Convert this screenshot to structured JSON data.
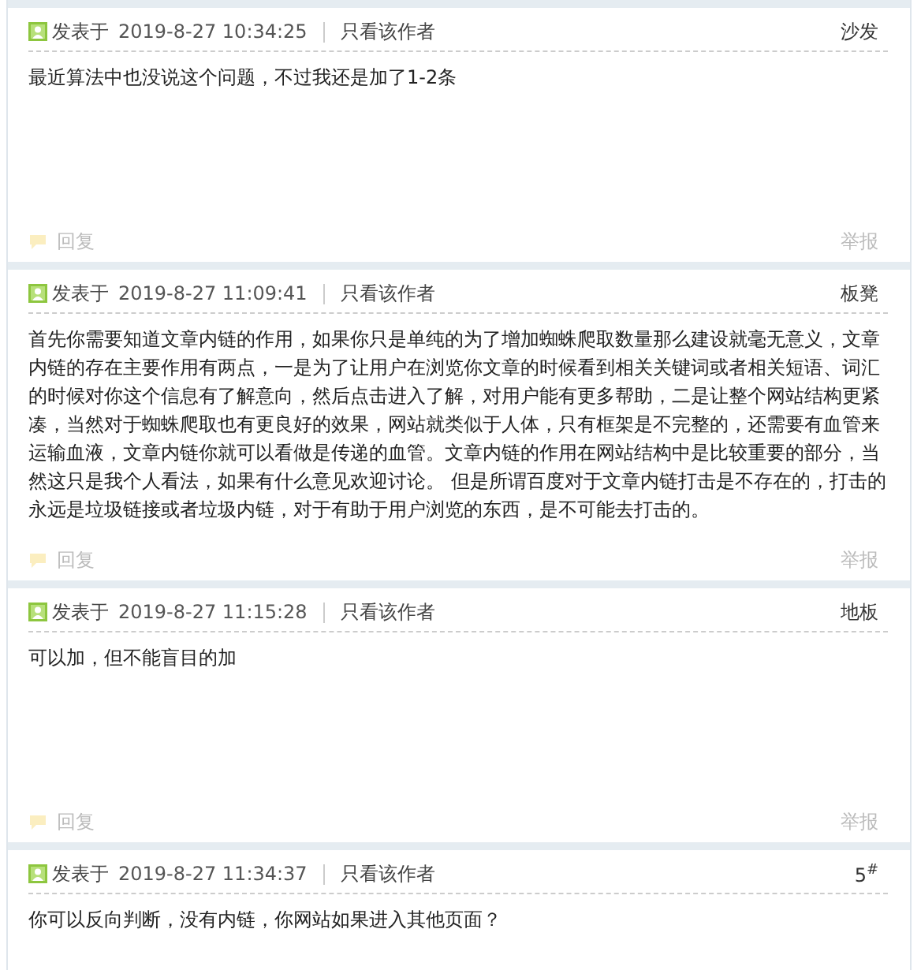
{
  "posts": [
    {
      "posted_label": "发表于",
      "time": "2019-8-27 10:34:25",
      "author_filter": "只看该作者",
      "floor": "沙发",
      "content": "最近算法中也没说这个问题，不过我还是加了1-2条",
      "reply": "回复",
      "report": "举报"
    },
    {
      "posted_label": "发表于",
      "time": "2019-8-27 11:09:41",
      "author_filter": "只看该作者",
      "floor": "板凳",
      "content": "首先你需要知道文章内链的作用，如果你只是单纯的为了增加蜘蛛爬取数量那么建设就毫无意义，文章内链的存在主要作用有两点，一是为了让用户在浏览你文章的时候看到相关关键词或者相关短语、词汇的时候对你这个信息有了解意向，然后点击进入了解，对用户能有更多帮助，二是让整个网站结构更紧凑，当然对于蜘蛛爬取也有更良好的效果，网站就类似于人体，只有框架是不完整的，还需要有血管来运输血液，文章内链你就可以看做是传递的血管。文章内链的作用在网站结构中是比较重要的部分，当然这只是我个人看法，如果有什么意见欢迎讨论。 但是所谓百度对于文章内链打击是不存在的，打击的永远是垃圾链接或者垃圾内链，对于有助于用户浏览的东西，是不可能去打击的。",
      "reply": "回复",
      "report": "举报"
    },
    {
      "posted_label": "发表于",
      "time": "2019-8-27 11:15:28",
      "author_filter": "只看该作者",
      "floor": "地板",
      "content": "可以加，但不能盲目的加",
      "reply": "回复",
      "report": "举报"
    },
    {
      "posted_label": "发表于",
      "time": "2019-8-27 11:34:37",
      "author_filter": "只看该作者",
      "floor": "5$^{#}$",
      "content": "你可以反向判断，没有内链，你网站如果进入其他页面？"
    }
  ]
}
